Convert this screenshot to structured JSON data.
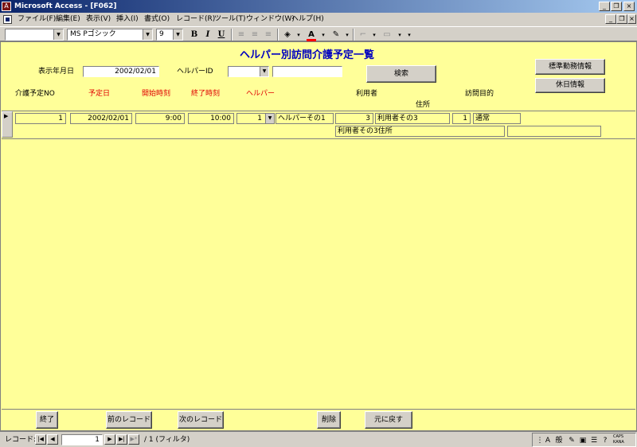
{
  "window": {
    "title": "Microsoft Access - [F062]",
    "min_icon": "minimize-icon",
    "restore_icon": "restore-icon",
    "close_icon": "close-icon"
  },
  "menu": {
    "items": [
      "ファイル(F)",
      "編集(E)",
      "表示(V)",
      "挿入(I)",
      "書式(O)",
      "レコード(R)",
      "ツール(T)",
      "ウィンドウ(W)",
      "ヘルプ(H)"
    ]
  },
  "toolbar": {
    "object_combo": "",
    "font_name": "MS Pゴシック",
    "font_size": "9",
    "bold": "B",
    "italic": "I",
    "underline": "U",
    "font_color": "#ff0000",
    "fill_icon": "fill-bucket-icon",
    "fontcolor_icon": "font-color-icon",
    "linecolor_icon": "line-color-icon"
  },
  "form": {
    "title": "ヘルパー別訪問介護予定一覧",
    "display_date_label": "表示年月日",
    "display_date_value": "2002/02/01",
    "helper_id_label": "ヘルパーID",
    "helper_id_value": "",
    "helper_name_value": "",
    "search_button": "検索",
    "standard_work_button": "標準勤務情報",
    "holiday_button": "休日情報",
    "columns": {
      "care_no": "介護予定NO",
      "planned_date": "予定日",
      "start_time": "開始時刻",
      "end_time": "終了時刻",
      "helper": "ヘルパー",
      "user": "利用者",
      "address": "住所",
      "purpose": "訪問目的"
    },
    "record": {
      "care_no": "1",
      "planned_date": "2002/02/01",
      "start_time": "9:00",
      "end_time": "10:00",
      "helper_id": "1",
      "helper_name": "ヘルパーその1",
      "user_id": "3",
      "user_name": "利用者その3",
      "purpose_id": "1",
      "purpose_name": "通常",
      "address": "利用者その3住所",
      "extra": ""
    },
    "footer_buttons": {
      "end": "終了",
      "prev": "前のレコード",
      "next": "次のレコード",
      "delete": "削除",
      "restore": "元に戻す"
    }
  },
  "navigation": {
    "record_label": "レコード:",
    "current": "1",
    "total_text": "/ 1 (フィルタ)"
  },
  "tray": {
    "ime_mode": "般",
    "caps": "CAPS",
    "kana": "KANA"
  }
}
